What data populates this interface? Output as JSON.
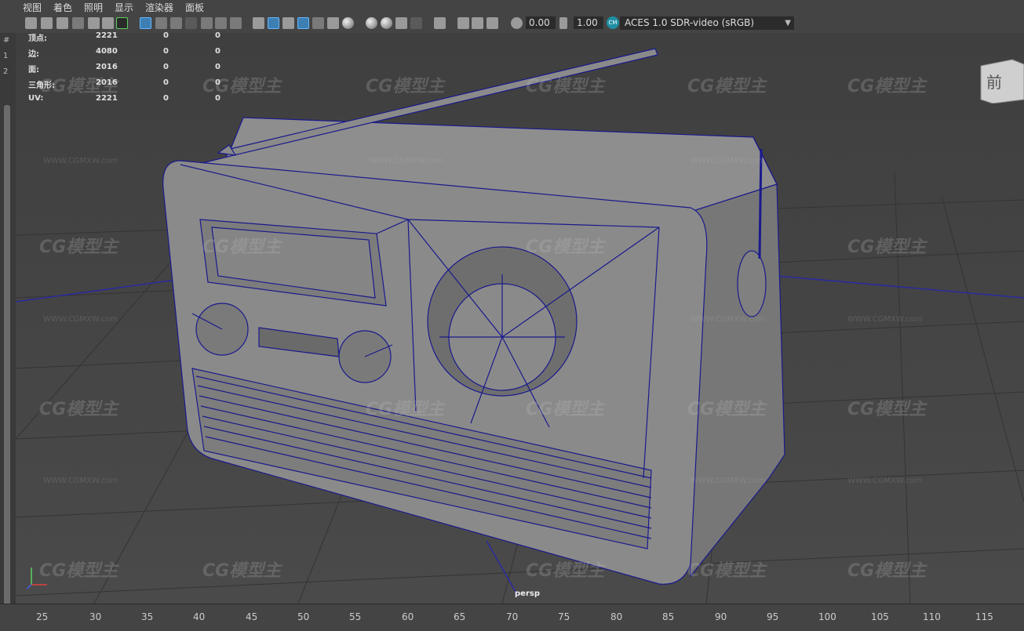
{
  "menu": [
    "视图",
    "着色",
    "照明",
    "显示",
    "渲染器",
    "面板"
  ],
  "toolbar": {
    "exposure": "0.00",
    "gamma": "1.00",
    "colorspace_icon": "CM",
    "colorspace": "ACES 1.0 SDR-video (sRGB)"
  },
  "hud": [
    {
      "label": "顶点:",
      "count": "2221",
      "a": "0",
      "b": "0"
    },
    {
      "label": "边:",
      "count": "4080",
      "a": "0",
      "b": "0"
    },
    {
      "label": "面:",
      "count": "2016",
      "a": "0",
      "b": "0"
    },
    {
      "label": "三角形:",
      "count": "2016",
      "a": "0",
      "b": "0"
    },
    {
      "label": "UV:",
      "count": "2221",
      "a": "0",
      "b": "0"
    }
  ],
  "viewcube_label": "前",
  "camera_label": "persp",
  "timeline": [
    "25",
    "30",
    "35",
    "40",
    "45",
    "50",
    "55",
    "60",
    "65",
    "70",
    "75",
    "80",
    "85",
    "90",
    "95",
    "100",
    "105",
    "110",
    "115"
  ],
  "watermark": {
    "logo": "CG模型主",
    "url": "WWW.CGMXW.com"
  },
  "left_strip_ticks": [
    "#",
    "1",
    "2"
  ],
  "colors": {
    "wire": "#1a1a8c",
    "grid_axis": "#2a2aa0",
    "ui_bg": "#444444",
    "viewport": "#454545"
  }
}
